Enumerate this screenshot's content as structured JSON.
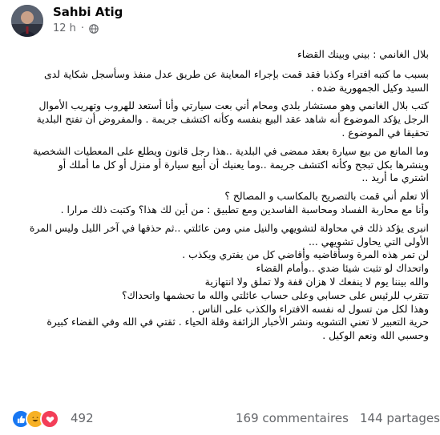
{
  "author": {
    "name": "Sahbi Atig",
    "time": "12 h",
    "separator": "·",
    "privacy_icon": "globe-icon"
  },
  "post": {
    "paragraphs": [
      [
        "بلال الغانمي : بيني وبينك القضاء"
      ],
      [
        "بسبب ما كتبه افتراء وكذبا فقد قمت بإجراء المعاينة عن طريق عدل منفذ  وسأسجل شكاية لدى",
        "السيد وكيل الجمهورية ضده ."
      ],
      [
        "كتب بلال الغانمي وهو مستشار بلدي ومحام أني بعت سيارتي وأنا أستعد للهروب وتهريب الأموال",
        "الرجل يؤكد الموضوع أنه شاهد عقد البيع بنفسه وكأنه اكتشف جريمة . والمفروض أن تفتح البلدية",
        "تحقيقا في الموضوع ."
      ],
      [
        "وما المانع من بيع سيارة بعقد ممضى في البلدية ..هذا رجل قانون ويطلع على المعطيات الشخصية",
        "وينشرها بكل تبجح وكأنه اكتشف جريمة ..وما يعنيك أن أبيع سيارة أو  منزل أو كل ما أملك أو",
        "اشتري ما أريد .."
      ],
      [
        "ألا تعلم أني قمت بالتصريح بالمكاسب و المصالح ؟",
        "وأنا مع محاربة الفساد ومحاسبة الفاسدين ومع تطبيق : من أين لك هذا؟ وكتبت ذلك مرارا ."
      ],
      [
        "انبرى يؤكد ذلك في محاولة لتشويهي والنيل مني ومن عائلتي ..ثم حذفها في آخر الليل وليس المرة",
        "الأولى التي يحاول تشويهي ...",
        "لن تمر هذه المرة   وسأقاضيه وأقاضي كل من يفتري ويكذب .",
        "واتحداك لو تثبت شيئا ضدي ..وأمام القضاء",
        "والله بيننا يوم لا ينفعك لا هزان قفة ولا تملق ولا انتهازية",
        "تتقرب للرئيس على حسابي وعلى حساب عائلتي والله ما تحشمها  واتحداك؟",
        "وهذا لكل من تسول له نفسه الافتراء والكذب على الناس .",
        "حرية التعبير لا تعني التشويه ونشر الأخبار الزائفة  وقلة الحياء . ثقتي في الله وفي القضاء كبيرة",
        "وحسبي الله ونعم الوكيل ."
      ]
    ]
  },
  "footer": {
    "reaction_icons": [
      "like-icon",
      "haha-icon",
      "love-icon"
    ],
    "reaction_count": "492",
    "comments": "169 commentaires",
    "shares": "144 partages"
  },
  "colors": {
    "like": "#1877f2",
    "haha": "#f7b125",
    "love": "#f33e58",
    "meta_text": "#65676b"
  }
}
